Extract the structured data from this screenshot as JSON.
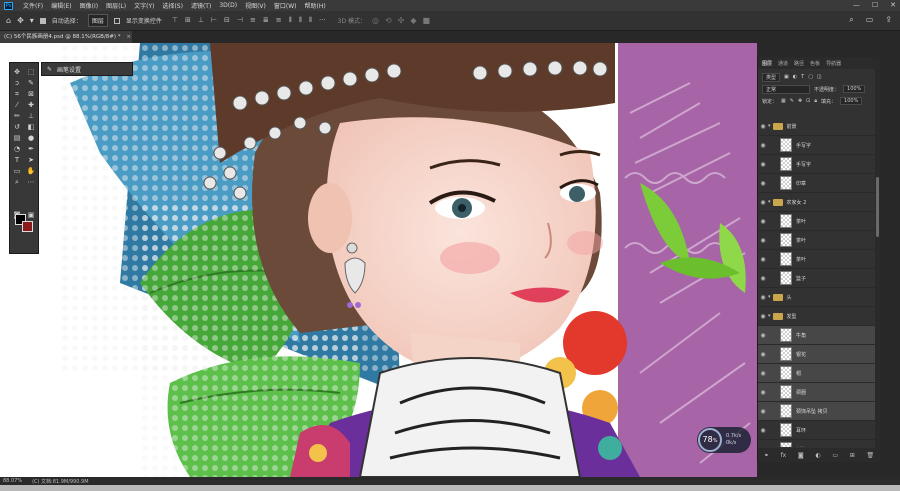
{
  "app": {
    "logo": "Ps"
  },
  "menu": [
    "文件(F)",
    "编辑(E)",
    "图像(I)",
    "图层(L)",
    "文字(Y)",
    "选择(S)",
    "滤镜(T)",
    "3D(D)",
    "视图(V)",
    "窗口(W)",
    "帮助(H)"
  ],
  "window_controls": {
    "minimize": "—",
    "maximize": "☐",
    "close": "✕"
  },
  "options": {
    "auto_select_label": "自动选择：",
    "auto_select_value": "图层",
    "transform_label": "显示变换控件",
    "mode_3d_label": "3D 模式："
  },
  "document": {
    "tab_title": "(C) 56个民族画册4.psd @ 88.1%(RGB/8#) *",
    "close_glyph": "×"
  },
  "brush_panel": {
    "title": "画笔设置"
  },
  "colors": {
    "foreground": "#000000",
    "background": "#8b1a1a",
    "accent": "#31a8ff",
    "canvas_purple": "#a764a7"
  },
  "layers_panel": {
    "tabs": [
      "图层",
      "通道",
      "路径",
      "色板",
      "导航器"
    ],
    "kind_filter": "类型",
    "blend_mode": "正常",
    "opacity_label": "不透明度：",
    "opacity_value": "100%",
    "lock_label": "锁定：",
    "fill_label": "填充：",
    "fill_value": "100%",
    "layers": [
      {
        "name": "前景",
        "type": "group",
        "selected": false
      },
      {
        "name": "手写字",
        "type": "layer",
        "selected": false
      },
      {
        "name": "手写字",
        "type": "layer",
        "selected": false
      },
      {
        "name": "印章",
        "type": "layer",
        "selected": false
      },
      {
        "name": "农家女 2",
        "type": "group",
        "selected": false
      },
      {
        "name": "茶叶",
        "type": "layer",
        "selected": false
      },
      {
        "name": "茶叶",
        "type": "layer",
        "selected": false
      },
      {
        "name": "茶叶",
        "type": "layer",
        "selected": false
      },
      {
        "name": "篮子",
        "type": "layer",
        "selected": false
      },
      {
        "name": "头",
        "type": "group",
        "selected": false
      },
      {
        "name": "发型",
        "type": "group",
        "selected": false
      },
      {
        "name": "牛角",
        "type": "layer",
        "selected": true
      },
      {
        "name": "银花",
        "type": "layer",
        "selected": true
      },
      {
        "name": "帽",
        "type": "layer",
        "selected": true
      },
      {
        "name": "颈圈",
        "type": "layer",
        "selected": true
      },
      {
        "name": "颈饰吊坠 拷贝",
        "type": "layer",
        "selected": true
      },
      {
        "name": "耳环",
        "type": "layer",
        "selected": false
      },
      {
        "name": "刘海",
        "type": "layer",
        "selected": false
      }
    ]
  },
  "zoom_badge": {
    "percent": "78",
    "unit": "%",
    "up": "0.7k/s",
    "down": "0k/s"
  },
  "status": {
    "zoom": "88.07%",
    "doc_info": "(C) 文档:81.9M/990.9M"
  }
}
